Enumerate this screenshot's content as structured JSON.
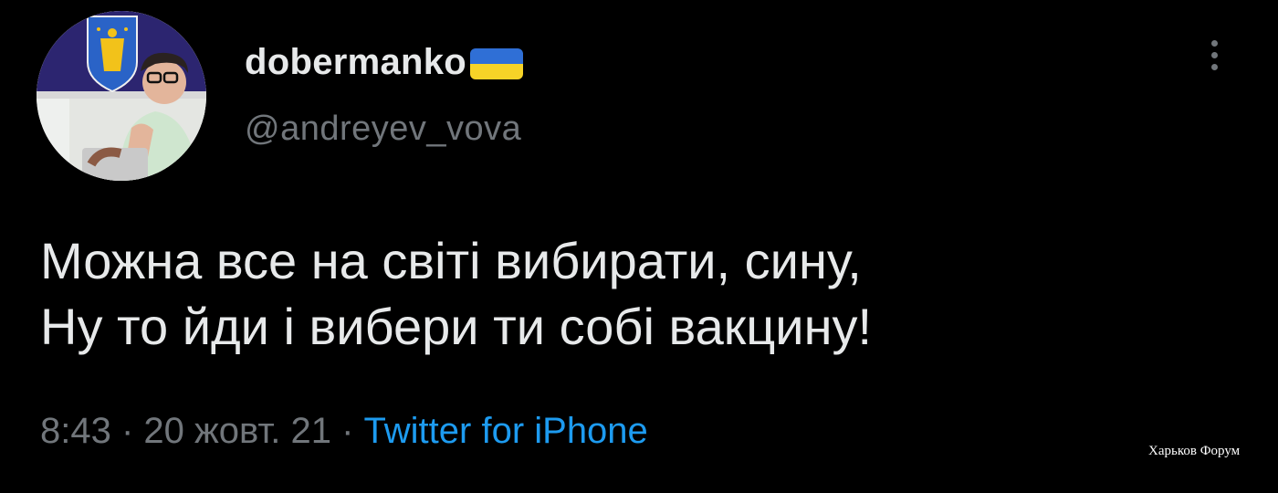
{
  "tweet": {
    "author": {
      "display_name": "dobermanko",
      "handle": "@andreyev_vova",
      "avatar": "avatar-photo"
    },
    "flag": {
      "icon": "ukraine-flag-icon",
      "top_color": "#2f6fd6",
      "bottom_color": "#f6d327"
    },
    "text_lines": [
      "Можна все на світі вибирати, сину,",
      "Ну то йди і вибери ти собі вакцину!"
    ],
    "meta": {
      "time": "8:43",
      "separator": " · ",
      "date": "20 жовт. 21",
      "source": "Twitter for iPhone"
    },
    "more_icon": "more-vertical-icon"
  },
  "watermark": "Харьков Форум",
  "colors": {
    "background": "#000000",
    "text": "#e7e9ea",
    "secondary": "#71767b",
    "link": "#1d9bf0"
  }
}
